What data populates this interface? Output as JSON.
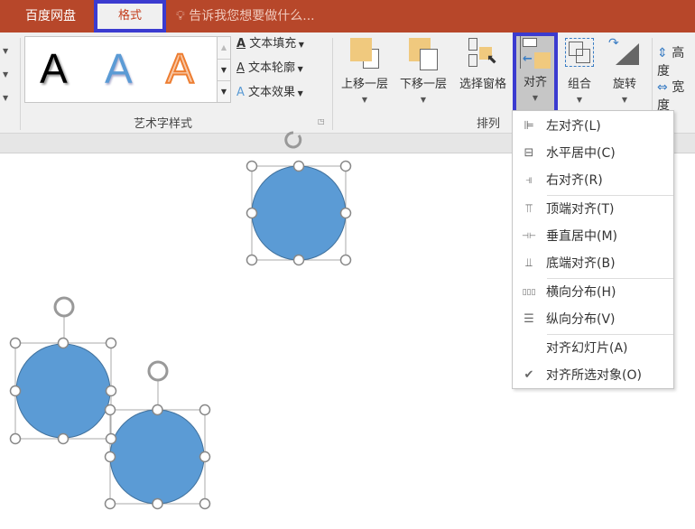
{
  "titlebar": {
    "tabs": [
      "百度网盘",
      "格式"
    ],
    "tell_me": "告诉我您想要做什么..."
  },
  "ribbon": {
    "wordart_group": {
      "label": "艺术字样式",
      "samples": [
        "A",
        "A",
        "A"
      ],
      "text_fill": "文本填充",
      "text_outline": "文本轮廓",
      "text_effects": "文本效果"
    },
    "arrange_group": {
      "label": "排列",
      "bring_forward": "上移一层",
      "send_backward": "下移一层",
      "selection_pane": "选择窗格",
      "align": "对齐",
      "group": "组合",
      "rotate": "旋转"
    },
    "size_group": {
      "height": "高度",
      "width": "宽度"
    }
  },
  "align_menu": [
    {
      "label": "左对齐(L)",
      "icon": "align-left-icon"
    },
    {
      "label": "水平居中(C)",
      "icon": "align-center-icon"
    },
    {
      "label": "右对齐(R)",
      "icon": "align-right-icon"
    },
    {
      "label": "顶端对齐(T)",
      "icon": "align-top-icon"
    },
    {
      "label": "垂直居中(M)",
      "icon": "align-middle-icon"
    },
    {
      "label": "底端对齐(B)",
      "icon": "align-bottom-icon"
    },
    {
      "label": "横向分布(H)",
      "icon": "distribute-horizontal-icon"
    },
    {
      "label": "纵向分布(V)",
      "icon": "distribute-vertical-icon"
    },
    {
      "label": "对齐幻灯片(A)",
      "icon": ""
    },
    {
      "label": "对齐所选对象(O)",
      "icon": "check-icon",
      "checked": true
    }
  ],
  "colors": {
    "titlebar": "#b7472a",
    "highlight": "#3b3bd0",
    "shape_fill": "#5b9bd5"
  }
}
